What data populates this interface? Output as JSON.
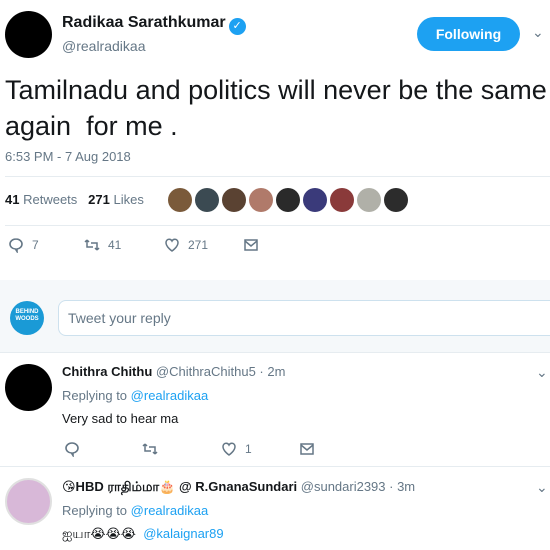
{
  "author": {
    "name": "Radikaa Sarathkumar",
    "handle": "@realradikaa",
    "follow_label": "Following"
  },
  "tweet": {
    "text": "Tamilnadu and politics will never be the same again  for me .",
    "timestamp": "6:53 PM - 7 Aug 2018",
    "retweets": "41",
    "retweets_label": "Retweets",
    "likes": "271",
    "likes_label": "Likes"
  },
  "actions": {
    "reply_count": "7",
    "retweet_count": "41",
    "like_count": "271"
  },
  "likers": [
    "#7a5a3a",
    "#3b4a52",
    "#5a4232",
    "#b07a6a",
    "#2a2a2a",
    "#3a3a7a",
    "#8a3a3a",
    "#b0b0a8",
    "#2c2c2c"
  ],
  "reply_box": {
    "logo_text": "BEHIND WOODS",
    "placeholder": "Tweet your reply"
  },
  "replies": [
    {
      "name": "Chithra Chithu",
      "handle": "@ChithraChithu5 · 2m",
      "replying_prefix": "Replying to",
      "replying_to": "@realradikaa",
      "text": "Very sad to hear ma",
      "like_count": "1"
    },
    {
      "name": "😘HBD ராதிம்மா🎂 @ R.GnanaSundari",
      "handle": "@sundari2393 · 3m",
      "replying_prefix": "Replying to",
      "replying_to": "@realradikaa",
      "text": "ஐயா😭😭😭",
      "mention": "@kalaignar89"
    }
  ],
  "colors": {
    "accent": "#1da1f2",
    "muted": "#657786",
    "text": "#14171a",
    "divider": "#e6ecf0"
  }
}
